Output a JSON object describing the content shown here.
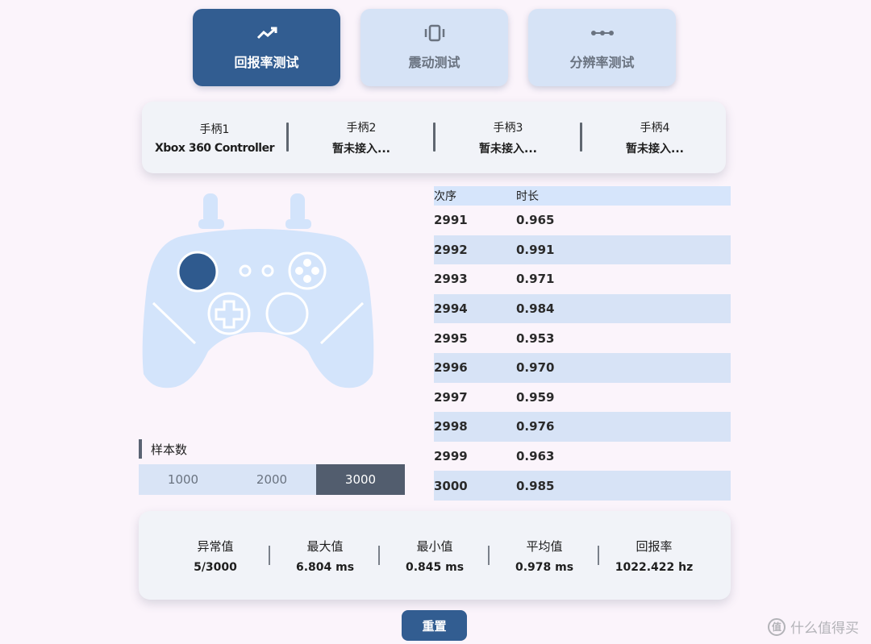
{
  "modes": [
    {
      "label": "回报率测试",
      "icon": "trending-up-icon"
    },
    {
      "label": "震动测试",
      "icon": "vibration-icon"
    },
    {
      "label": "分辨率测试",
      "icon": "dots-line-icon"
    }
  ],
  "controllers": [
    {
      "name": "手柄1",
      "status": "Xbox 360 Controller"
    },
    {
      "name": "手柄2",
      "status": "暂未接入..."
    },
    {
      "name": "手柄3",
      "status": "暂未接入..."
    },
    {
      "name": "手柄4",
      "status": "暂未接入..."
    }
  ],
  "table": {
    "headers": [
      "次序",
      "时长"
    ],
    "rows": [
      [
        "2991",
        "0.965"
      ],
      [
        "2992",
        "0.991"
      ],
      [
        "2993",
        "0.971"
      ],
      [
        "2994",
        "0.984"
      ],
      [
        "2995",
        "0.953"
      ],
      [
        "2996",
        "0.970"
      ],
      [
        "2997",
        "0.959"
      ],
      [
        "2998",
        "0.976"
      ],
      [
        "2999",
        "0.963"
      ],
      [
        "3000",
        "0.985"
      ]
    ]
  },
  "samples": {
    "label": "样本数",
    "options": [
      "1000",
      "2000",
      "3000"
    ],
    "selected": "3000"
  },
  "stats": [
    {
      "label": "异常值",
      "value": "5/3000"
    },
    {
      "label": "最大值",
      "value": "6.804 ms"
    },
    {
      "label": "最小值",
      "value": "0.845 ms"
    },
    {
      "label": "平均值",
      "value": "0.978 ms"
    },
    {
      "label": "回报率",
      "value": "1022.422 hz"
    }
  ],
  "reset_label": "重置",
  "watermark": "什么值得买",
  "colors": {
    "accent": "#325d91",
    "light": "#d6e3f6",
    "selected": "#525d6e"
  }
}
